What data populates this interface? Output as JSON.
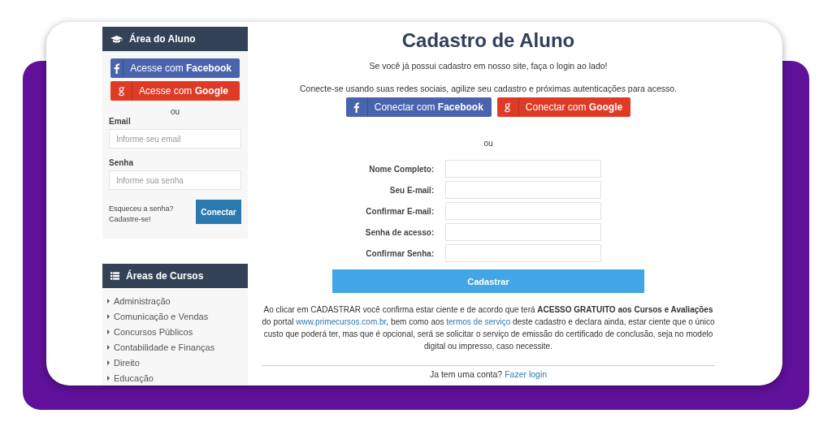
{
  "sidebar": {
    "login_panel": {
      "title": "Área do Aluno",
      "social_buttons": [
        {
          "kind": "facebook",
          "text": "Acesse com **Facebook**"
        },
        {
          "kind": "google",
          "text": "Acesse com **Google**"
        }
      ],
      "separator": "ou",
      "fields": [
        {
          "label": "Email",
          "placeholder": "Informe seu email"
        },
        {
          "label": "Senha",
          "placeholder": "Informe sua senha"
        }
      ],
      "links": [
        "Esqueceu a senha?",
        "Cadastre-se!"
      ],
      "submit": "Conectar"
    },
    "courses_panel": {
      "title": "Áreas de Cursos",
      "items": [
        "Administração",
        "Comunicação e Vendas",
        "Concursos Públicos",
        "Contabilidade e Finanças",
        "Direito",
        "Educação"
      ]
    }
  },
  "main": {
    "title": "Cadastro de Aluno",
    "intro": "Se você já possui cadastro em nosso site, faça o login ao lado!",
    "social_text": "Conecte-se usando suas redes sociais, agilize seu cadastro e próximas autenticações para acesso.",
    "social_buttons": [
      {
        "kind": "facebook",
        "text": "Conectar com **Facebook**"
      },
      {
        "kind": "google",
        "text": "Conectar com **Google**"
      }
    ],
    "separator": "ou",
    "form": {
      "fields": [
        {
          "label": "Nome Completo:"
        },
        {
          "label": "Seu E-mail:"
        },
        {
          "label": "Confirmar E-mail:"
        },
        {
          "label": "Senha de acesso:"
        },
        {
          "label": "Confirmar Senha:"
        }
      ],
      "submit": "Cadastrar"
    },
    "terms": [
      {
        "kind": "text",
        "text": "Ao clicar em CADASTRAR você confirma estar ciente e de acordo que terá **ACESSO GRATUITO aos Cursos e Avaliações** do portal "
      },
      {
        "kind": "link",
        "text": "www.primecursos.com.br"
      },
      {
        "kind": "text",
        "text": ", bem como aos "
      },
      {
        "kind": "link",
        "text": "termos de serviço"
      },
      {
        "kind": "text",
        "text": " deste cadastro e declara ainda, estar ciente que o único custo que poderá ter, mas que é opcional, será se solicitar o serviço de emissão do certificado de conclusão, seja no modelo digital ou impresso, caso necessite."
      }
    ],
    "footer": {
      "text": "Ja tem uma conta?",
      "link": "Fazer login"
    }
  }
}
